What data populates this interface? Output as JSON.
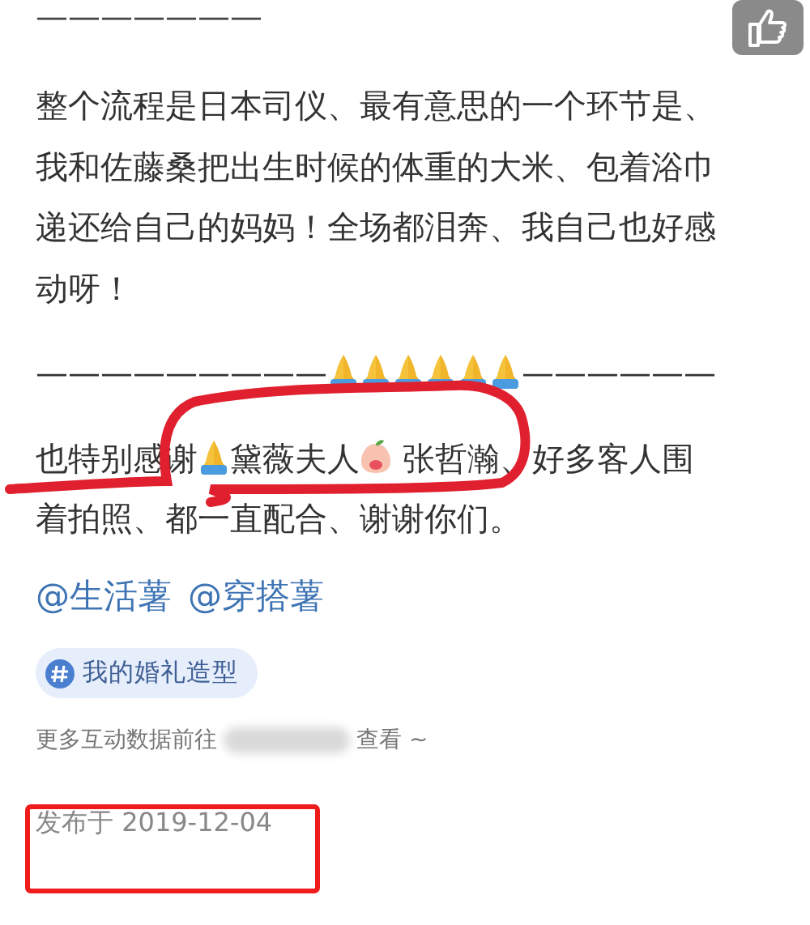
{
  "like_button": {
    "selected": false
  },
  "top_divider": "———————",
  "paragraphs": [
    {
      "lines": [
        {
          "segments": [
            {
              "kind": "text",
              "text": "整个流程是日本司仪、最有意思的一个环节是、"
            }
          ]
        },
        {
          "segments": [
            {
              "kind": "text",
              "text": "我和佐藤桑把出生时候的体重的大米、包着浴巾"
            }
          ]
        },
        {
          "segments": [
            {
              "kind": "text",
              "text": "递还给自己的妈妈！全场都泪奔、我自己也好感"
            }
          ]
        },
        {
          "segments": [
            {
              "kind": "text",
              "text": "动呀！"
            }
          ]
        }
      ]
    },
    {
      "lines": [
        {
          "segments": [
            {
              "kind": "text",
              "text": "—————————"
            },
            {
              "kind": "hands"
            },
            {
              "kind": "hands"
            },
            {
              "kind": "hands"
            },
            {
              "kind": "hands"
            },
            {
              "kind": "hands"
            },
            {
              "kind": "hands"
            },
            {
              "kind": "text",
              "text": "——————"
            }
          ]
        }
      ]
    },
    {
      "lines": [
        {
          "segments": [
            {
              "kind": "text",
              "text": "也特别感谢"
            },
            {
              "kind": "hands"
            },
            {
              "kind": "text",
              "text": "黛薇夫人"
            },
            {
              "kind": "peach"
            },
            {
              "kind": "text",
              "text": " 张哲瀚、好多客人围"
            }
          ]
        },
        {
          "segments": [
            {
              "kind": "text",
              "text": "着拍照、都一直配合、谢谢你们。"
            }
          ]
        }
      ]
    }
  ],
  "mentions": [
    "@生活薯",
    "@穿搭薯"
  ],
  "topic_tag": "我的婚礼造型",
  "interaction_note": {
    "before": "更多互动数据前往",
    "redacted": true,
    "after": "查看 ~"
  },
  "published": "发布于 2019-12-04",
  "annotations": [
    {
      "kind": "loop",
      "color": "#e0202e"
    },
    {
      "kind": "box",
      "color": "#f01c1c"
    }
  ]
}
